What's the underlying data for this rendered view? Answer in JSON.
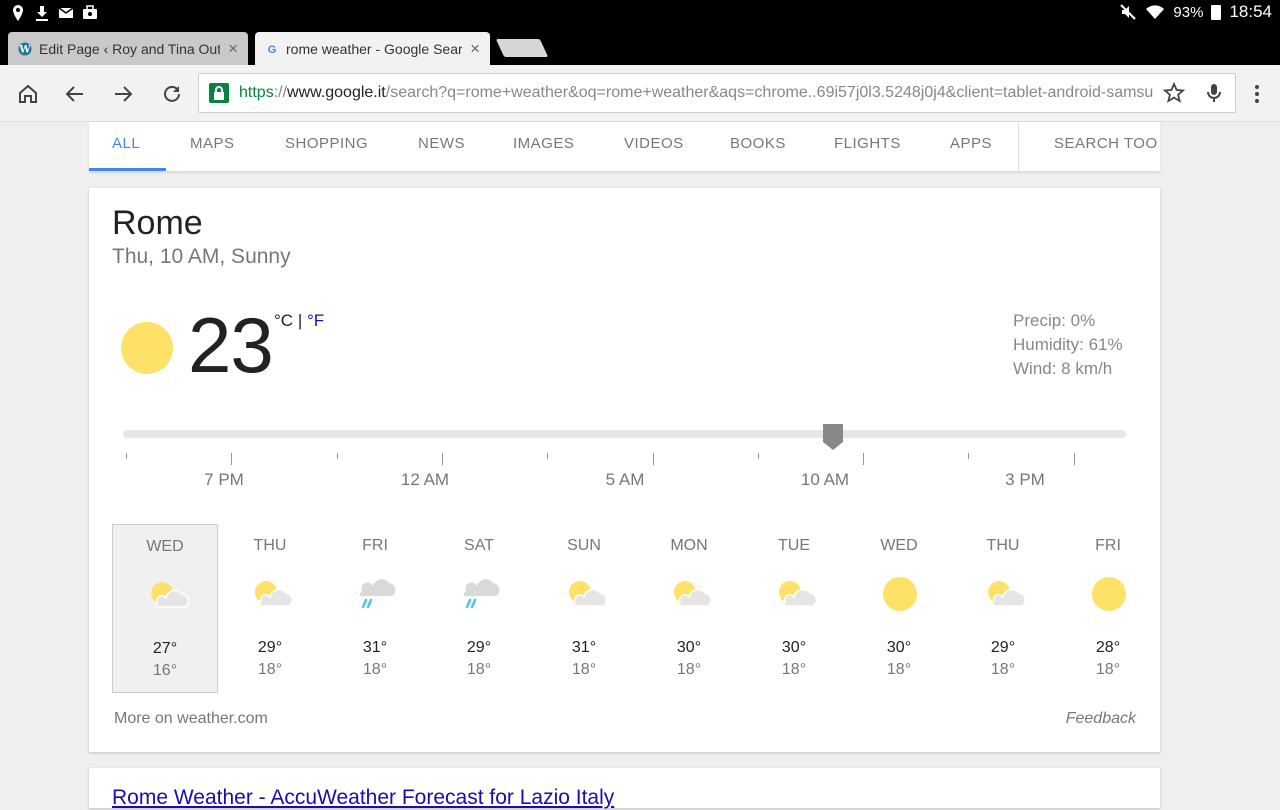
{
  "status": {
    "battery": "93%",
    "time": "18:54"
  },
  "tabs": [
    {
      "title": "Edit Page ‹ Roy and Tina Out",
      "close": "×"
    },
    {
      "title": "rome weather - Google Searc",
      "close": "×"
    }
  ],
  "omnibox": {
    "scheme": "https",
    "sep": "://",
    "host": "www.google.it",
    "path": "/search?q=rome+weather&oq=rome+weather&aqs=chrome..69i57j0l3.5248j0j4&client=tablet-android-samsu"
  },
  "search_tabs": [
    "ALL",
    "MAPS",
    "SHOPPING",
    "NEWS",
    "IMAGES",
    "VIDEOS",
    "BOOKS",
    "FLIGHTS",
    "APPS",
    "SEARCH TOO"
  ],
  "weather": {
    "city": "Rome",
    "subtitle": "Thu, 10 AM, Sunny",
    "temperature": "23",
    "unit_c": "°C",
    "unit_sep": "|",
    "unit_f": "°F",
    "precip": "Precip: 0%",
    "humidity": "Humidity: 61%",
    "wind": "Wind: 8 km/h",
    "time_labels": [
      "7 PM",
      "12 AM",
      "5 AM",
      "10 AM",
      "3 PM"
    ],
    "slider_position": 0.708,
    "days": [
      {
        "name": "WED",
        "high": "27°",
        "low": "16°",
        "icon": "partly-cloudy-icon",
        "selected": true
      },
      {
        "name": "THU",
        "high": "29°",
        "low": "18°",
        "icon": "partly-cloudy-icon"
      },
      {
        "name": "FRI",
        "high": "31°",
        "low": "18°",
        "icon": "rain-icon"
      },
      {
        "name": "SAT",
        "high": "29°",
        "low": "18°",
        "icon": "rain-icon"
      },
      {
        "name": "SUN",
        "high": "31°",
        "low": "18°",
        "icon": "partly-cloudy-icon"
      },
      {
        "name": "MON",
        "high": "30°",
        "low": "18°",
        "icon": "partly-cloudy-icon"
      },
      {
        "name": "TUE",
        "high": "30°",
        "low": "18°",
        "icon": "partly-cloudy-icon"
      },
      {
        "name": "WED",
        "high": "30°",
        "low": "18°",
        "icon": "sun-icon"
      },
      {
        "name": "THU",
        "high": "29°",
        "low": "18°",
        "icon": "partly-cloudy-icon"
      },
      {
        "name": "FRI",
        "high": "28°",
        "low": "18°",
        "icon": "sun-icon"
      }
    ],
    "more_link": "More on weather.com",
    "feedback": "Feedback"
  },
  "next_result": {
    "title": "Rome Weather - AccuWeather Forecast for Lazio Italy"
  },
  "colors": {
    "accent": "#4285f4",
    "sun": "#fde169",
    "link": "#1a0dab",
    "secure": "#0b8043"
  }
}
